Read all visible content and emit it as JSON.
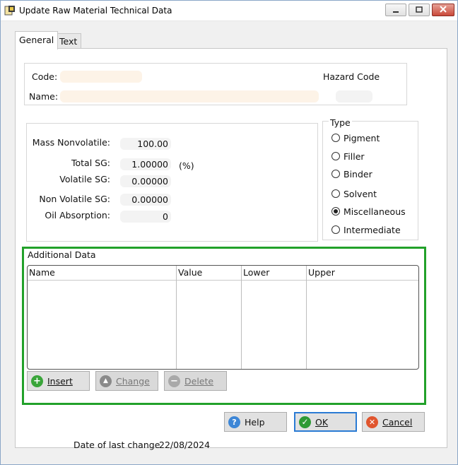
{
  "window": {
    "title": "Update Raw Material Technical Data"
  },
  "tabs": [
    {
      "label": "General",
      "active": true
    },
    {
      "label": "Text",
      "active": false
    }
  ],
  "identity": {
    "code_label": "Code:",
    "code_value": "",
    "name_label": "Name:",
    "name_value": "",
    "hazard_label": "Hazard Code",
    "hazard_value": ""
  },
  "properties": {
    "mass_nonvolatile": {
      "label": "Mass Nonvolatile:",
      "value": "100.00"
    },
    "total_sg": {
      "label": "Total SG:",
      "value": "1.00000",
      "unit": "(%)"
    },
    "volatile_sg": {
      "label": "Volatile SG:",
      "value": "0.00000"
    },
    "non_volatile_sg": {
      "label": "Non Volatile SG:",
      "value": "0.00000"
    },
    "oil_absorption": {
      "label": "Oil Absorption:",
      "value": "0"
    }
  },
  "type": {
    "title": "Type",
    "selected": "Miscellaneous",
    "options": [
      "Pigment",
      "Filler",
      "Binder",
      "Solvent",
      "Miscellaneous",
      "Intermediate"
    ]
  },
  "additional_data": {
    "title": "Additional Data",
    "columns": [
      "Name",
      "Value",
      "Lower",
      "Upper"
    ],
    "rows": [],
    "buttons": {
      "insert": "Insert",
      "change": "Change",
      "delete": "Delete"
    }
  },
  "footer": {
    "date_label": "Date of last change",
    "date_value": "22/08/2024",
    "help": "Help",
    "ok": "OK",
    "cancel": "Cancel"
  },
  "colors": {
    "highlight": "#22a12a",
    "field_bg": "#fdf3e7"
  }
}
